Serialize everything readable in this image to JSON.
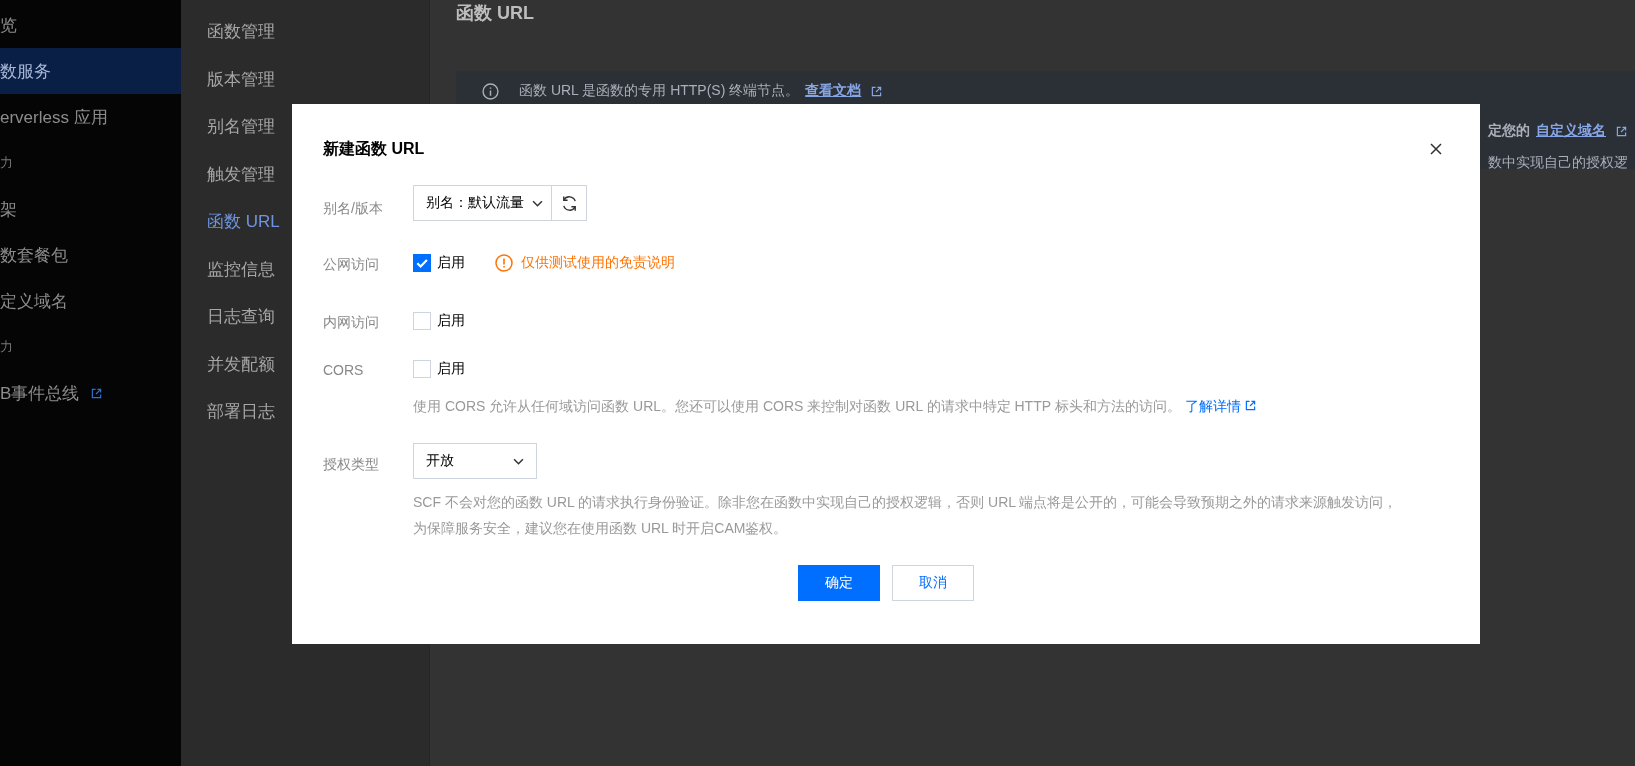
{
  "sidebar": {
    "items": [
      {
        "label": "览",
        "selected": false,
        "external": false,
        "kind": "item"
      },
      {
        "label": "数服务",
        "selected": true,
        "external": false,
        "kind": "item"
      },
      {
        "label": "erverless 应用",
        "selected": false,
        "external": false,
        "kind": "item"
      },
      {
        "label": "力",
        "kind": "group"
      },
      {
        "label": "架",
        "selected": false,
        "external": false,
        "kind": "item"
      },
      {
        "label": "数套餐包",
        "selected": false,
        "external": false,
        "kind": "item"
      },
      {
        "label": "定义域名",
        "selected": false,
        "external": false,
        "kind": "item"
      },
      {
        "label": "力",
        "kind": "group"
      },
      {
        "label": "B事件总线",
        "selected": false,
        "external": true,
        "kind": "item"
      }
    ]
  },
  "subnav": {
    "items": [
      {
        "label": "函数管理",
        "selected": false
      },
      {
        "label": "版本管理",
        "selected": false
      },
      {
        "label": "别名管理",
        "selected": false
      },
      {
        "label": "触发管理",
        "selected": false
      },
      {
        "label": "函数 URL",
        "selected": true
      },
      {
        "label": "监控信息",
        "selected": false
      },
      {
        "label": "日志查询",
        "selected": false
      },
      {
        "label": "并发配额",
        "selected": false
      },
      {
        "label": "部署日志",
        "selected": false
      }
    ]
  },
  "page": {
    "title": "函数 URL",
    "notice": {
      "line_1": {
        "text": "函数 URL 是函数的专用 HTTP(S) 终端节点。",
        "link": "查看文档"
      },
      "line_2": {
        "text": "定您的",
        "link": "自定义域名"
      },
      "line_3": {
        "text": "数中实现自己的授权逻"
      }
    }
  },
  "dialog": {
    "title": "新建函数 URL",
    "fields": [
      {
        "kind": "select-refresh",
        "label": "别名/版本",
        "value": "别名：默认流量"
      },
      {
        "kind": "checkbox",
        "label": "公网访问",
        "option": "启用",
        "checked": true,
        "warning": "仅供测试使用的免责说明"
      },
      {
        "kind": "checkbox",
        "label": "内网访问",
        "option": "启用",
        "checked": false
      },
      {
        "kind": "checkbox",
        "label": "CORS",
        "option": "启用",
        "checked": false,
        "description": "使用 CORS 允许从任何域访问函数 URL。您还可以使用 CORS 来控制对函数 URL 的请求中特定 HTTP 标头和方法的访问。",
        "link": "了解详情"
      },
      {
        "kind": "select",
        "label": "授权类型",
        "value": "开放",
        "description": "SCF 不会对您的函数 URL 的请求执行身份验证。除非您在函数中实现自己的授权逻辑，否则 URL 端点将是公开的，可能会导致预期之外的请求来源触发访问，为保障服务安全，建议您在使用函数 URL 时开启CAM鉴权。"
      }
    ],
    "buttons": [
      {
        "label": "确定",
        "kind": "primary"
      },
      {
        "label": "取消",
        "kind": "default"
      }
    ]
  }
}
